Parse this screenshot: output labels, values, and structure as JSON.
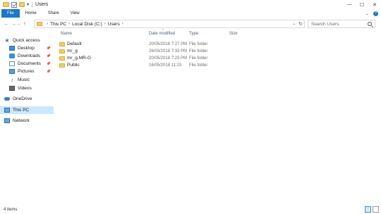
{
  "window": {
    "title": "Users",
    "controls": [
      "—",
      "☐",
      "✕"
    ]
  },
  "ribbon": {
    "tabs": [
      "File",
      "Home",
      "Share",
      "View"
    ]
  },
  "address": {
    "crumbs": [
      "This PC",
      "Local Disk (C:)",
      "Users"
    ]
  },
  "search": {
    "placeholder": "Search Users"
  },
  "navigation": {
    "items": [
      {
        "label": "Quick access",
        "icon": "star-icon"
      },
      {
        "label": "Desktop",
        "icon": "desktop-icon",
        "pinned": true
      },
      {
        "label": "Downloads",
        "icon": "downloads-icon",
        "pinned": true
      },
      {
        "label": "Documents",
        "icon": "documents-icon",
        "pinned": true
      },
      {
        "label": "Pictures",
        "icon": "pictures-icon",
        "pinned": true
      },
      {
        "label": "Music",
        "icon": "music-icon"
      },
      {
        "label": "Videos",
        "icon": "videos-icon"
      },
      {
        "label": "OneDrive",
        "icon": "onedrive-icon"
      },
      {
        "label": "This PC",
        "icon": "this-pc-icon",
        "selected": true
      },
      {
        "label": "Network",
        "icon": "network-icon"
      }
    ]
  },
  "columns": {
    "name": "Name",
    "date": "Date modified",
    "type": "Type",
    "size": "Size"
  },
  "files": [
    {
      "name": "Default",
      "date": "20/05/2018 7:27 PM",
      "type": "File folder"
    },
    {
      "name": "mr_g",
      "date": "26/03/2018 7:33 PM",
      "type": "File folder"
    },
    {
      "name": "mr_g.MR-G",
      "date": "20/05/2018 7:23 PM",
      "type": "File folder"
    },
    {
      "name": "Public",
      "date": "16/05/2018 11:23",
      "type": "File folder"
    }
  ],
  "status": {
    "item_count": "4 items"
  },
  "colors": {
    "accent": "#1979ca",
    "selection": "#cce8ff",
    "folder": "#f3cd61"
  }
}
